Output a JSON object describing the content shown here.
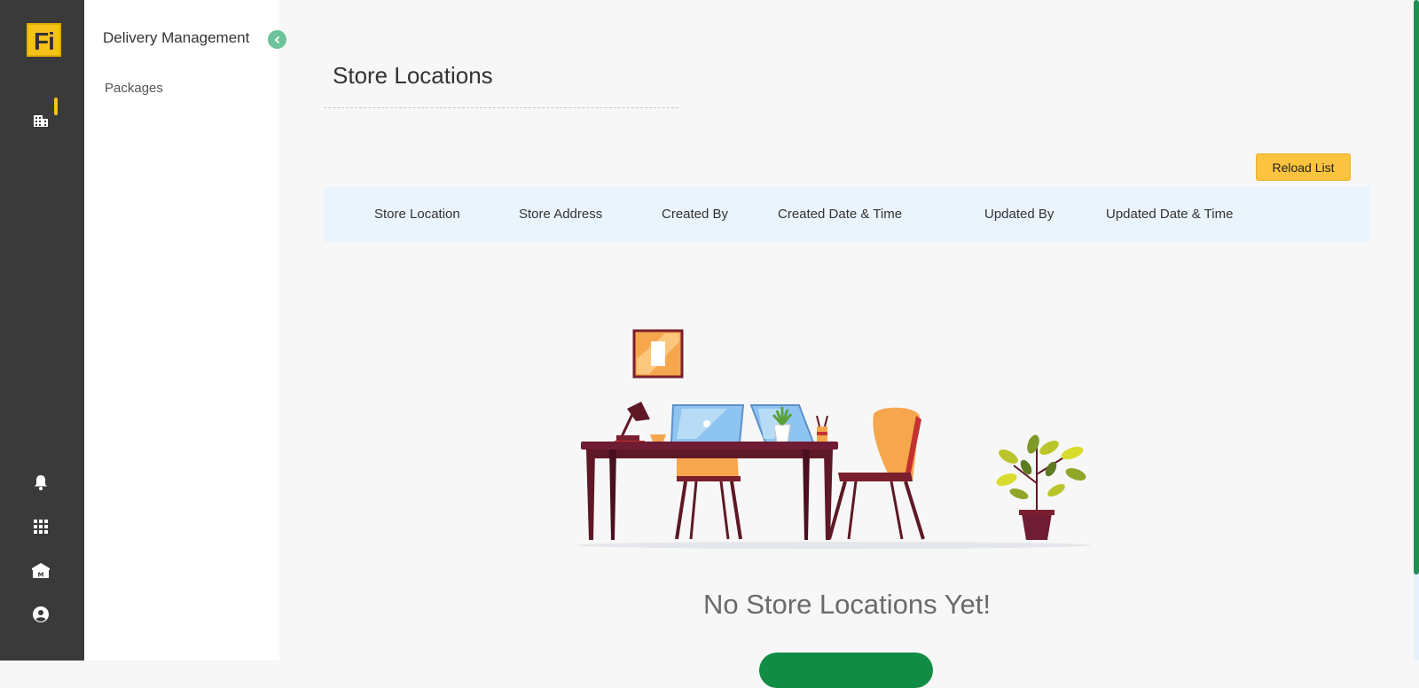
{
  "rail": {
    "logo_text": "Fi",
    "icons": [
      "building-icon",
      "bell-icon",
      "apps-grid-icon",
      "bank-icon",
      "account-circle-icon"
    ]
  },
  "subnav": {
    "title": "Delivery Management",
    "items": [
      {
        "label": "Packages"
      }
    ]
  },
  "main": {
    "page_title": "Store Locations",
    "reload_label": "Reload List",
    "columns": [
      "Store Location",
      "Store Address",
      "Created By",
      "Created Date & Time",
      "Updated By",
      "Updated Date & Time"
    ],
    "empty_state_text": "No Store Locations Yet!"
  },
  "colors": {
    "rail_bg": "#3a3a3a",
    "accent_yellow": "#fcc33e",
    "accent_green": "#118c45",
    "table_header_bg": "#eaf4fd"
  }
}
